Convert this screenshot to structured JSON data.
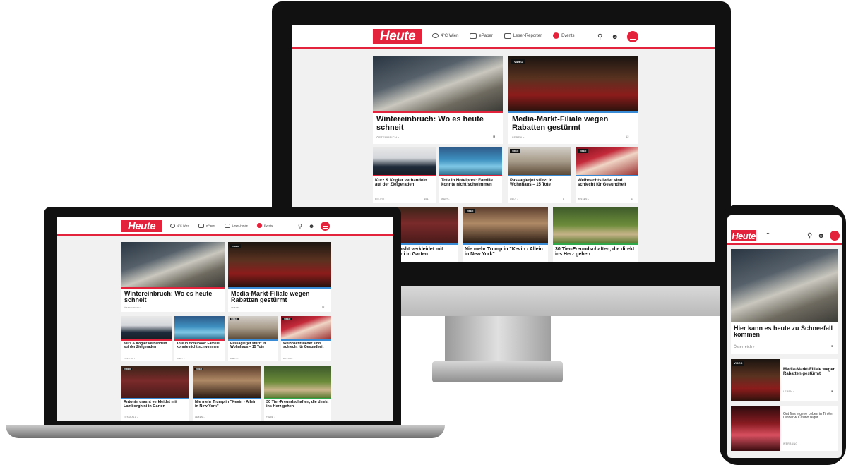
{
  "brand": {
    "logo_text": "Heute",
    "accent": "#e3223b",
    "video_blue": "#3a8bd6"
  },
  "header": {
    "weather": "4°C Wien",
    "epaper": "ePaper",
    "leser_reporter": "Leser-Reporter",
    "events": "Events",
    "laptop_leser": "Leser-Heute"
  },
  "icons": {
    "search": "search-icon",
    "user": "user-icon",
    "menu": "menu-icon"
  },
  "video_badge": "VIDEO",
  "desktop": {
    "hero_left": {
      "title": "Wintereinbruch: Wo es heute schneit",
      "category": "ÖSTERREICH ›"
    },
    "hero_right": {
      "title": "Media-Markt-Filiale wegen Rabatten gestürmt",
      "category": "LEBEN ›",
      "comments": "12"
    },
    "row2": [
      {
        "title": "Kurz & Kogler verhandeln auf der Zielgeraden",
        "category": "POLITIK ›",
        "comments": "151"
      },
      {
        "title": "Tote in Hotelpool: Familie konnte nicht schwimmen",
        "category": "WELT ›",
        "comments": ""
      },
      {
        "title": "Passagierjet stürzt in Wohnhaus – 15 Tote",
        "category": "WELT ›",
        "comments": "8"
      },
      {
        "title": "Weihnachtslieder sind schlecht für Gesundheit",
        "category": "WISSEN ›",
        "comments": "11"
      }
    ],
    "row3": [
      {
        "title": "Antonin crasht verkleidet mit Lamborghini in Garten"
      },
      {
        "title": "Nie mehr Trump in \"Kevin - Allein in New York\""
      },
      {
        "title": "30 Tier-Freundschaften, die direkt ins Herz gehen"
      }
    ]
  },
  "laptop": {
    "hero_left": {
      "title": "Wintereinbruch: Wo es heute schneit",
      "category": "ÖSTERREICH ›"
    },
    "hero_right": {
      "title": "Media-Markt-Filiale wegen Rabatten gestürmt",
      "category": "LEBEN ›",
      "comments": "12"
    },
    "row2": [
      {
        "title": "Kurz & Kogler verhandeln auf der Zielgeraden",
        "category": "POLITIK ›"
      },
      {
        "title": "Tote in Hotelpool: Familie konnte nicht schwimmen",
        "category": "WELT ›"
      },
      {
        "title": "Passagierjet stürzt in Wohnhaus – 15 Tote",
        "category": "WELT ›"
      },
      {
        "title": "Weihnachtslieder sind schlecht für Gesundheit",
        "category": "WISSEN ›"
      }
    ],
    "row3": [
      {
        "title": "Antonin crasht verkleidet mit Lamborghini in Garten",
        "category": "FUSSBALL ›"
      },
      {
        "title": "Nie mehr Trump in \"Kevin - Allein in New York\"",
        "category": "LEBEN ›"
      },
      {
        "title": "30 Tier-Freundschaften, die direkt ins Herz gehen",
        "category": "TIERE ›"
      }
    ]
  },
  "phone": {
    "hero": {
      "title": "Hier kann es heute zu Schneefall kommen",
      "category": "Österreich ›"
    },
    "item1": {
      "title": "Media-Markt-Filiale wegen Rabatten gestürmt",
      "category": "LEBEN ›"
    },
    "item2": {
      "title": "Gut fürs eigene Leben in Tiroler Dinner & Casino Night",
      "category": "WERBUNG"
    }
  }
}
